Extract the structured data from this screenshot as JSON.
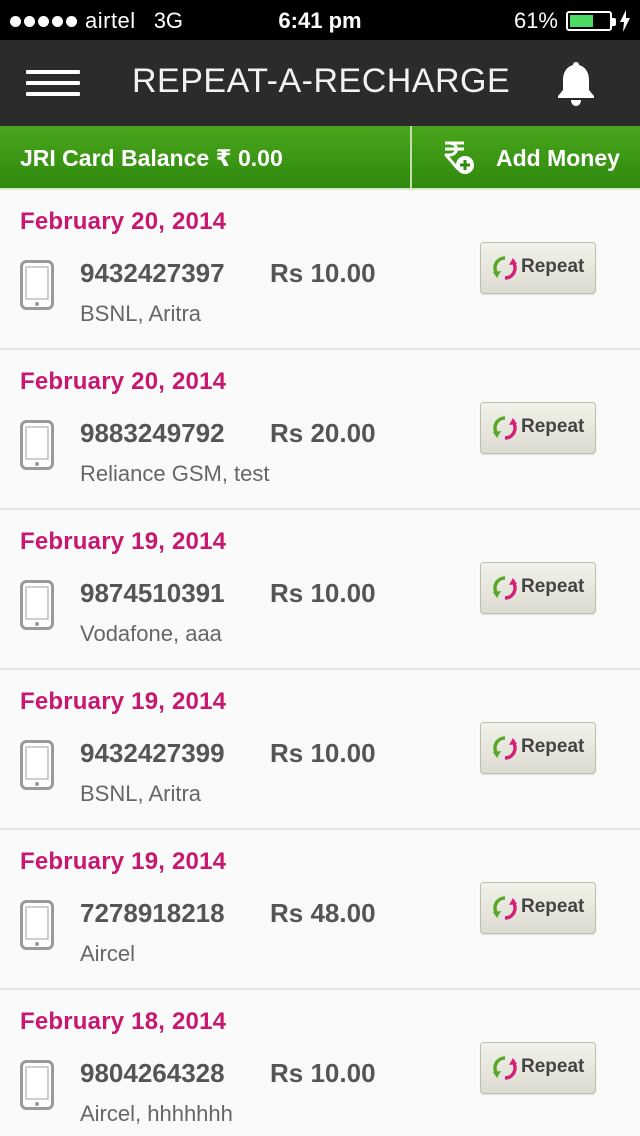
{
  "status_bar": {
    "carrier": "airtel",
    "network": "3G",
    "time": "6:41 pm",
    "battery": "61%",
    "battery_level": 0.61
  },
  "header": {
    "title": "REPEAT-A-RECHARGE",
    "menu_icon": "hamburger-menu-icon",
    "bell_icon": "bell-icon"
  },
  "balance_bar": {
    "balance_text": "JRI Card Balance ₹ 0.00",
    "add_money_label": "Add Money",
    "accent_color": "#3a9a16"
  },
  "colors": {
    "date_color": "#c9176f",
    "repeat_icon_green": "#5aa829",
    "repeat_icon_pink": "#d0207a"
  },
  "recharges": [
    {
      "date": "February 20, 2014",
      "number": "9432427397",
      "amount": "Rs 10.00",
      "operator": "BSNL, Aritra",
      "button": "Repeat"
    },
    {
      "date": "February 20, 2014",
      "number": "9883249792",
      "amount": "Rs 20.00",
      "operator": "Reliance GSM, test",
      "button": "Repeat"
    },
    {
      "date": "February 19, 2014",
      "number": "9874510391",
      "amount": "Rs 10.00",
      "operator": "Vodafone, aaa",
      "button": "Repeat"
    },
    {
      "date": "February 19, 2014",
      "number": "9432427399",
      "amount": "Rs 10.00",
      "operator": "BSNL, Aritra",
      "button": "Repeat"
    },
    {
      "date": "February 19, 2014",
      "number": "7278918218",
      "amount": "Rs 48.00",
      "operator": "Aircel",
      "button": "Repeat"
    },
    {
      "date": "February 18, 2014",
      "number": "9804264328",
      "amount": "Rs 10.00",
      "operator": "Aircel, hhhhhhh",
      "button": "Repeat"
    }
  ]
}
